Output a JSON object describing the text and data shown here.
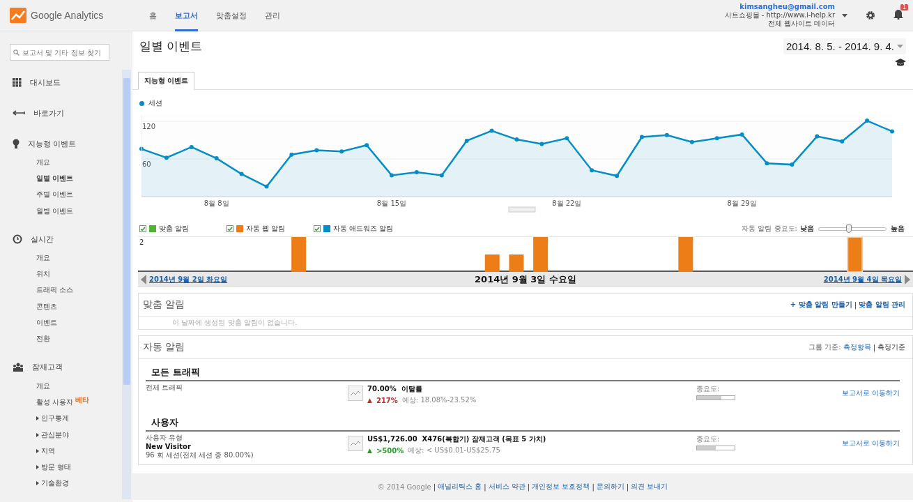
{
  "header": {
    "brand": "Google Analytics",
    "nav": [
      {
        "label": "홈",
        "selected": false
      },
      {
        "label": "보고서",
        "selected": true
      },
      {
        "label": "맞춤설정",
        "selected": false
      },
      {
        "label": "관리",
        "selected": false
      }
    ],
    "account": {
      "email": "kimsangheu@gmail.com",
      "property": "사트쇼핑몰 - http://www.i-help.kr",
      "view": "전체 웹사이트 데이터"
    },
    "notifications": "1"
  },
  "sidebar": {
    "search": {
      "placeholder": "보고서 및 기타 정보 찾기"
    },
    "sections": [
      {
        "label": "대시보드"
      },
      {
        "label": "바로가기"
      },
      {
        "label": "지능형 이벤트",
        "items": [
          {
            "label": "개요",
            "kind": "link",
            "selected": false
          },
          {
            "label": "일별 이벤트",
            "kind": "link",
            "selected": true
          },
          {
            "label": "주별 이벤트",
            "kind": "link",
            "selected": false
          },
          {
            "label": "월별 이벤트",
            "kind": "link",
            "selected": false
          }
        ]
      },
      {
        "label": "실시간",
        "items": [
          {
            "label": "개요",
            "kind": "link",
            "selected": false
          },
          {
            "label": "위치",
            "kind": "link",
            "selected": false
          },
          {
            "label": "트래픽 소스",
            "kind": "link",
            "selected": false
          },
          {
            "label": "콘텐츠",
            "kind": "link",
            "selected": false
          },
          {
            "label": "이벤트",
            "kind": "link",
            "selected": false
          },
          {
            "label": "전환",
            "kind": "link",
            "selected": false
          }
        ]
      },
      {
        "label": "잠재고객",
        "items": [
          {
            "label": "개요",
            "kind": "link",
            "selected": false
          },
          {
            "label": "활성 사용자",
            "kind": "link",
            "selected": false,
            "badge": "베타"
          },
          {
            "label": "인구통계",
            "kind": "folder",
            "selected": false
          },
          {
            "label": "관심분야",
            "kind": "folder",
            "selected": false
          },
          {
            "label": "지역",
            "kind": "folder",
            "selected": false
          },
          {
            "label": "방문 형태",
            "kind": "folder",
            "selected": false
          },
          {
            "label": "기술환경",
            "kind": "folder",
            "selected": false
          }
        ]
      }
    ]
  },
  "page": {
    "title": "일별 이벤트",
    "date_range": "2014. 8. 5. - 2014. 9. 4.",
    "tab": {
      "label": "지능형 이벤트",
      "selected": true
    }
  },
  "sessions_chart": {
    "chart_data": {
      "type": "area",
      "categories": [
        null,
        null,
        null,
        "8월 8일",
        null,
        null,
        null,
        null,
        null,
        null,
        "8월 15일",
        null,
        null,
        null,
        null,
        null,
        null,
        "8월 22일",
        null,
        null,
        null,
        null,
        null,
        null,
        "8월 29일",
        null,
        null,
        null,
        null,
        null,
        null
      ],
      "yticks": [
        60,
        120
      ],
      "ylim": [
        0,
        130
      ],
      "series": [
        {
          "name": "세션",
          "color": "#058dc7",
          "marker": true,
          "values": [
            76,
            62,
            79,
            61,
            36,
            16,
            67,
            74,
            72,
            82,
            34,
            39,
            34,
            89,
            105,
            91,
            84,
            93,
            42,
            33,
            95,
            98,
            87,
            93,
            99,
            53,
            51,
            96,
            88,
            121,
            104
          ]
        }
      ]
    }
  },
  "alerts_legend": [
    {
      "label": "맞춤 알림",
      "checked": true,
      "color": "#50b432"
    },
    {
      "label": "자동 웹 알림",
      "checked": true,
      "color": "#ed7e17"
    },
    {
      "label": "자동 애드워즈 알림",
      "checked": true,
      "color": "#058dc7"
    }
  ],
  "importance": {
    "label": "자동 알림 중요도:",
    "low": "낮음",
    "high": "높음",
    "level": 0.45
  },
  "events_axis": "2",
  "date_nav": {
    "prev": "2014년 9월 2일 화요일",
    "current": "2014년 9월 3일 수요일",
    "next": "2014년 9월 4일 목요일"
  },
  "custom_alerts": {
    "title": "맞춤 알림",
    "create": "+ 맞춤 알림 만들기",
    "separator": "|",
    "manage": "맞춤 알림 관리",
    "empty": "이 날짜에 생성된 맞춤 알림이 없습니다."
  },
  "auto_alerts": {
    "title": "자동 알림",
    "group_by": "그룹 기준:",
    "group_metric": "측정항목",
    "separator": "|",
    "group_dimension": "측정기준",
    "groups": [
      {
        "title": "모든 트래픽",
        "rows": [
          {
            "segment": "전체 트래픽",
            "value": "70.00%",
            "metric": "이탈률",
            "arrow": "▲",
            "change": "217%",
            "color": "#b9302c",
            "expected": "예상: 18.08%-23.52%",
            "importance_label": "중요도:",
            "level": 0.65,
            "link": "보고서로 이동하기"
          }
        ]
      },
      {
        "title": "사용자",
        "rows": [
          {
            "dimension": "사용자 유형",
            "segment": "New Visitor",
            "detail": "96 회 세션(전체 세션 중 80.00%)",
            "value": "US$1,726.00",
            "metric": "X476(복합기) 잠재고객 (목표 5 가치)",
            "arrow": "▲",
            "change": ">500%",
            "color": "#2a9a2a",
            "expected": "예상: < US$0.01-US$25.75",
            "importance_label": "중요도:",
            "level": 0.5,
            "link": "보고서로 이동하기"
          }
        ]
      }
    ]
  },
  "footer": {
    "copyright": "© 2014 Google",
    "links": [
      {
        "separator": "|",
        "label": "애널리틱스 홈"
      },
      {
        "separator": "|",
        "label": "서비스 약관"
      },
      {
        "separator": "|",
        "label": "개인정보 보호정책"
      },
      {
        "separator": "|",
        "label": "문의하기"
      },
      {
        "separator": "|",
        "label": "의견 보내기"
      }
    ]
  }
}
